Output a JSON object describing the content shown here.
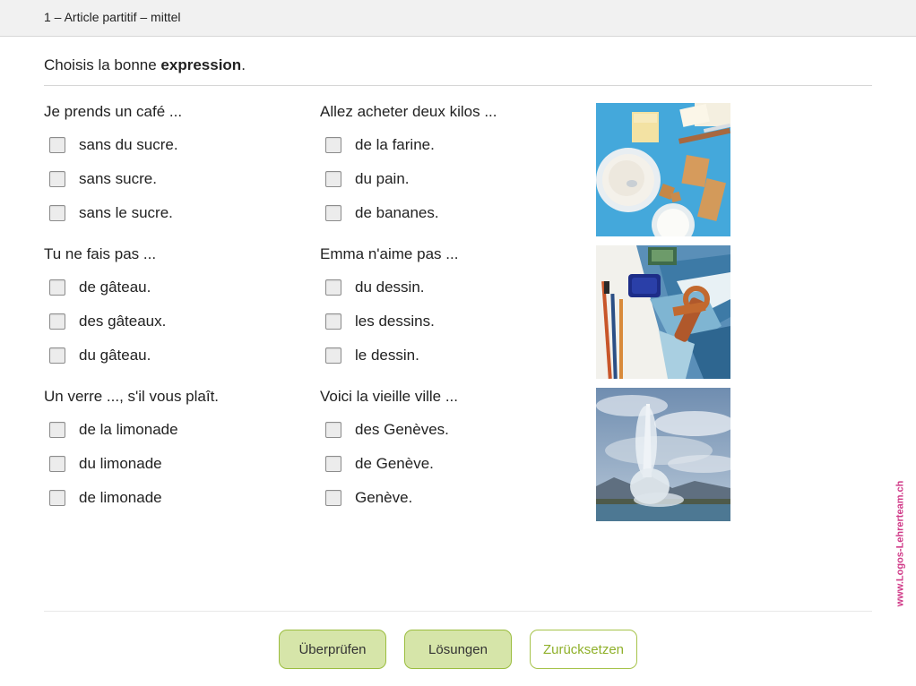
{
  "header": {
    "title": "1 – Article partitif – mittel"
  },
  "instruction": {
    "text_before": "Choisis la bonne ",
    "text_bold": "expression",
    "text_after": "."
  },
  "questions": [
    {
      "prompt": "Je prends un café ...",
      "options": [
        "sans du sucre.",
        "sans sucre.",
        "sans le sucre."
      ]
    },
    {
      "prompt": "Allez acheter deux kilos ...",
      "options": [
        "de la farine.",
        "du pain.",
        "de bananes."
      ]
    },
    {
      "prompt": "Tu ne fais pas ...",
      "options": [
        "de gâteau.",
        "des gâteaux.",
        "du gâteau."
      ]
    },
    {
      "prompt": "Emma n'aime pas ...",
      "options": [
        "du dessin.",
        "les dessins.",
        "le dessin."
      ]
    },
    {
      "prompt": "Un verre ..., s'il vous plaît.",
      "options": [
        "de la limonade",
        "du limonade",
        "de limonade"
      ]
    },
    {
      "prompt": "Voici la vieille ville ...",
      "options": [
        "des Genèves.",
        "de Genève.",
        "Genève."
      ]
    }
  ],
  "buttons": {
    "check": "Überprüfen",
    "solutions": "Lösungen",
    "reset": "Zurücksetzen"
  },
  "branding": {
    "site": "www.Logos-Lehrerteam.ch",
    "color": "#d03a88"
  },
  "colors": {
    "button_fill": "#d6e5a9",
    "button_border": "#9bbd3f",
    "reset_text": "#8fb02a"
  }
}
